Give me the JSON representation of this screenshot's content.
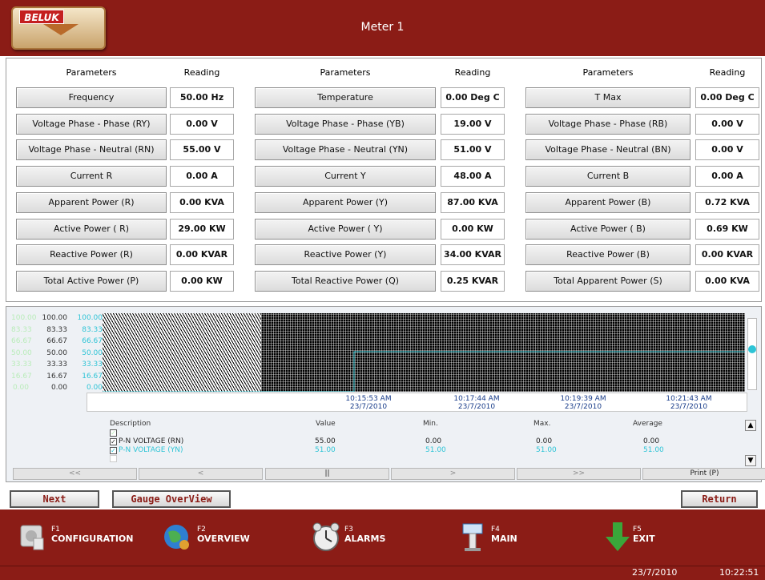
{
  "header": {
    "logo_text": "BELUK",
    "title": "Meter 1"
  },
  "columns": {
    "parameters_label": "Parameters",
    "reading_label": "Reading"
  },
  "params": {
    "col1": [
      {
        "label": "Frequency",
        "value": "50.00 Hz"
      },
      {
        "label": "Voltage Phase - Phase (RY)",
        "value": "0.00 V"
      },
      {
        "label": "Voltage Phase - Neutral (RN)",
        "value": "55.00 V"
      },
      {
        "label": "Current R",
        "value": "0.00 A"
      },
      {
        "label": "Apparent Power (R)",
        "value": "0.00 KVA"
      },
      {
        "label": "Active Power ( R)",
        "value": "29.00 KW"
      },
      {
        "label": "Reactive Power (R)",
        "value": "0.00 KVAR"
      },
      {
        "label": "Total Active Power (P)",
        "value": "0.00 KW"
      }
    ],
    "col2": [
      {
        "label": "Temperature",
        "value": "0.00 Deg C"
      },
      {
        "label": "Voltage Phase - Phase (YB)",
        "value": "19.00 V"
      },
      {
        "label": "Voltage Phase - Neutral (YN)",
        "value": "51.00 V"
      },
      {
        "label": "Current Y",
        "value": "48.00 A"
      },
      {
        "label": "Apparent Power (Y)",
        "value": "87.00 KVA"
      },
      {
        "label": "Active Power ( Y)",
        "value": "0.00 KW"
      },
      {
        "label": "Reactive Power (Y)",
        "value": "34.00 KVAR"
      },
      {
        "label": "Total Reactive Power (Q)",
        "value": "0.25 KVAR"
      }
    ],
    "col3": [
      {
        "label": "T Max",
        "value": "0.00 Deg C"
      },
      {
        "label": "Voltage Phase - Phase (RB)",
        "value": "0.00 V"
      },
      {
        "label": "Voltage Phase - Neutral (BN)",
        "value": "0.00 V"
      },
      {
        "label": "Current B",
        "value": "0.00 A"
      },
      {
        "label": "Apparent Power (B)",
        "value": "0.72 KVA"
      },
      {
        "label": "Active Power ( B)",
        "value": "0.69 KW"
      },
      {
        "label": "Reactive Power (B)",
        "value": "0.00 KVAR"
      },
      {
        "label": "Total Apparent Power (S)",
        "value": "0.00 KVA"
      }
    ]
  },
  "trend": {
    "y_ticks": [
      "100.00",
      "83.33",
      "66.67",
      "50.00",
      "33.33",
      "16.67",
      "0.00"
    ],
    "time_labels": [
      {
        "time": "10:15:53 AM",
        "date": "23/7/2010"
      },
      {
        "time": "10:17:44 AM",
        "date": "23/7/2010"
      },
      {
        "time": "10:19:39 AM",
        "date": "23/7/2010"
      },
      {
        "time": "10:21:43 AM",
        "date": "23/7/2010"
      }
    ],
    "legend_headers": {
      "description": "Description",
      "value": "Value",
      "min": "Min.",
      "max": "Max.",
      "average": "Average"
    },
    "legend_rows": [
      {
        "name": "P-N VOLTAGE (RN)",
        "value": "55.00",
        "min": "0.00",
        "max": "0.00",
        "avg": "0.00",
        "color": "#222222"
      },
      {
        "name": "P-N VOLTAGE (YN)",
        "value": "51.00",
        "min": "51.00",
        "max": "51.00",
        "avg": "51.00",
        "color": "#2ec4d6"
      }
    ],
    "nav": [
      "<<",
      "<",
      "||",
      ">",
      ">>",
      "Print (P)"
    ],
    "trace_color": "#3fd3e0"
  },
  "buttons": {
    "next": "Next",
    "gauge": "Gauge OverView",
    "return": "Return"
  },
  "footer": [
    {
      "key": "F1",
      "label": "CONFIGURATION"
    },
    {
      "key": "F2",
      "label": "OVERVIEW"
    },
    {
      "key": "F3",
      "label": "ALARMS"
    },
    {
      "key": "F4",
      "label": "MAIN"
    },
    {
      "key": "F5",
      "label": "EXIT"
    }
  ],
  "status": {
    "date": "23/7/2010",
    "time": "10:22:51"
  },
  "colors": {
    "brand": "#8b1c16"
  }
}
